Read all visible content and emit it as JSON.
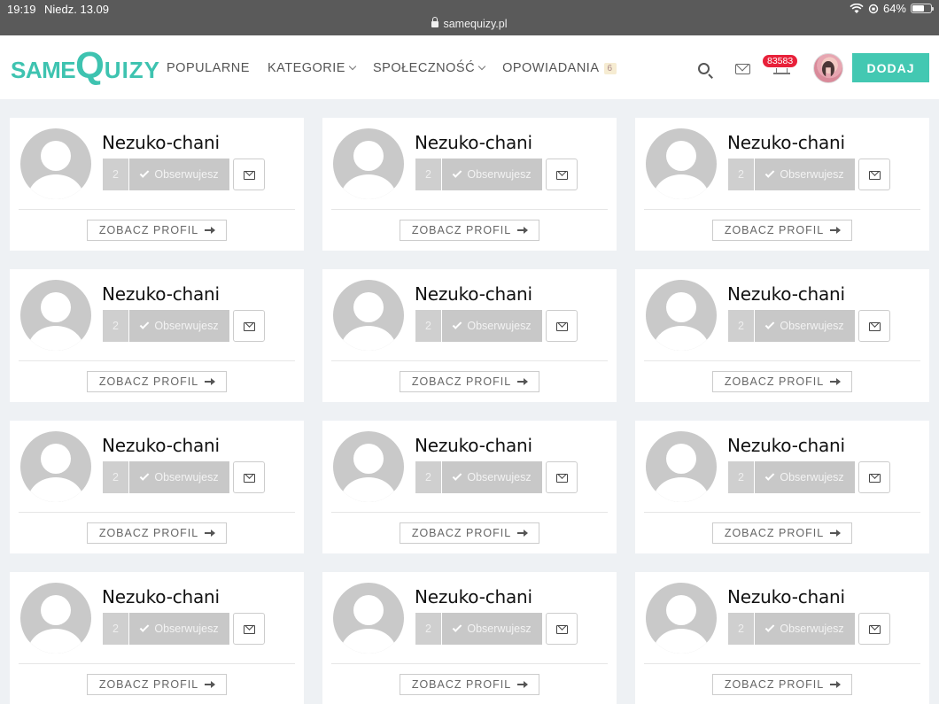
{
  "status_bar": {
    "time": "19:19",
    "date": "Niedz. 13.09",
    "url": "samequizy.pl",
    "battery": "64%",
    "battery_level": 0.64
  },
  "header": {
    "logo": {
      "part1": "SAME",
      "part2": "Q",
      "part3": "UIZY"
    },
    "nav": [
      {
        "label": "POPULARNE",
        "has_dropdown": false
      },
      {
        "label": "KATEGORIE",
        "has_dropdown": true
      },
      {
        "label": "SPOŁECZNOŚĆ",
        "has_dropdown": true
      },
      {
        "label": "OPOWIADANIA",
        "badge": "6"
      }
    ],
    "notification_count": "83583",
    "add_button": "DODAJ",
    "icons": [
      "search-icon",
      "mail-icon",
      "bell-icon"
    ]
  },
  "colors": {
    "brand": "#43c8b2",
    "notification": "#e8213a"
  },
  "cards": [
    {
      "name": "Nezuko-chani",
      "followers": "2",
      "follow_label": "Obserwujesz",
      "profile_label": "ZOBACZ PROFIL"
    },
    {
      "name": "Nezuko-chani",
      "followers": "2",
      "follow_label": "Obserwujesz",
      "profile_label": "ZOBACZ PROFIL"
    },
    {
      "name": "Nezuko-chani",
      "followers": "2",
      "follow_label": "Obserwujesz",
      "profile_label": "ZOBACZ PROFIL"
    },
    {
      "name": "Nezuko-chani",
      "followers": "2",
      "follow_label": "Obserwujesz",
      "profile_label": "ZOBACZ PROFIL"
    },
    {
      "name": "Nezuko-chani",
      "followers": "2",
      "follow_label": "Obserwujesz",
      "profile_label": "ZOBACZ PROFIL"
    },
    {
      "name": "Nezuko-chani",
      "followers": "2",
      "follow_label": "Obserwujesz",
      "profile_label": "ZOBACZ PROFIL"
    },
    {
      "name": "Nezuko-chani",
      "followers": "2",
      "follow_label": "Obserwujesz",
      "profile_label": "ZOBACZ PROFIL"
    },
    {
      "name": "Nezuko-chani",
      "followers": "2",
      "follow_label": "Obserwujesz",
      "profile_label": "ZOBACZ PROFIL"
    },
    {
      "name": "Nezuko-chani",
      "followers": "2",
      "follow_label": "Obserwujesz",
      "profile_label": "ZOBACZ PROFIL"
    },
    {
      "name": "Nezuko-chani",
      "followers": "2",
      "follow_label": "Obserwujesz",
      "profile_label": "ZOBACZ PROFIL"
    },
    {
      "name": "Nezuko-chani",
      "followers": "2",
      "follow_label": "Obserwujesz",
      "profile_label": "ZOBACZ PROFIL"
    },
    {
      "name": "Nezuko-chani",
      "followers": "2",
      "follow_label": "Obserwujesz",
      "profile_label": "ZOBACZ PROFIL"
    }
  ]
}
